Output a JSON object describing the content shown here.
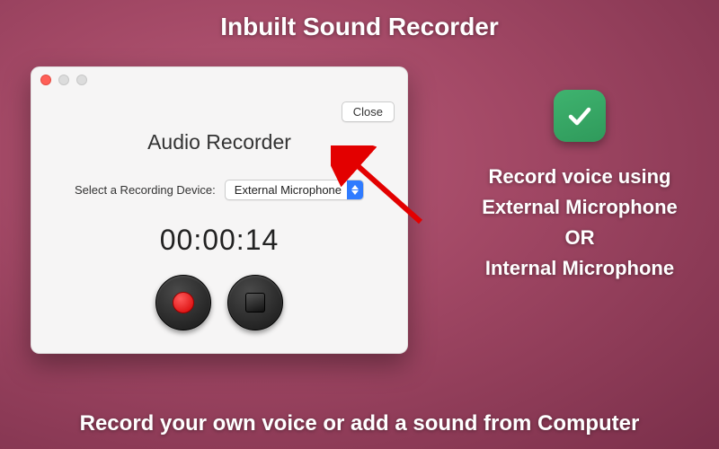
{
  "headline": "Inbuilt Sound Recorder",
  "footline": "Record your own voice or add a sound from Computer",
  "feature": {
    "line1": "Record voice using",
    "line2": "External Microphone",
    "line3": "OR",
    "line4": "Internal Microphone"
  },
  "window": {
    "title": "Audio Recorder",
    "close_label": "Close",
    "device_label": "Select a Recording Device:",
    "device_selected": "External Microphone",
    "timer": "00:00:14"
  }
}
